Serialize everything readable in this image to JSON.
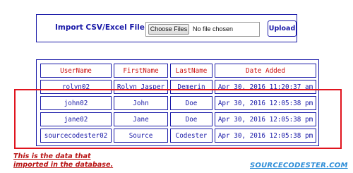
{
  "import_form": {
    "label": "Import CSV/Excel File:",
    "choose_button_label": "Choose Files",
    "file_status": "No file chosen",
    "upload_button_label": "Upload"
  },
  "table": {
    "headers": [
      "UserName",
      "FirstName",
      "LastName",
      "Date Added"
    ],
    "rows": [
      [
        "rolyn02",
        "Rolyn Jasper",
        "Demerin",
        "Apr 30, 2016 11:20:37 am"
      ],
      [
        "john02",
        "John",
        "Doe",
        "Apr 30, 2016 12:05:38 pm"
      ],
      [
        "jane02",
        "Jane",
        "Doe",
        "Apr 30, 2016 12:05:38 pm"
      ],
      [
        "sourcecodester02",
        "Source",
        "Codester",
        "Apr 30, 2016 12:05:38 pm"
      ]
    ]
  },
  "annotation": {
    "caption_line1": "This is the data that",
    "caption_line2": "imported in the database.",
    "highlight_color": "#e0141e"
  },
  "watermark": {
    "text": "SOURCECODESTER.COM"
  },
  "colors": {
    "primary": "#1a1aa8",
    "header_text": "#cc1111",
    "brand": "#2f8ed8"
  }
}
